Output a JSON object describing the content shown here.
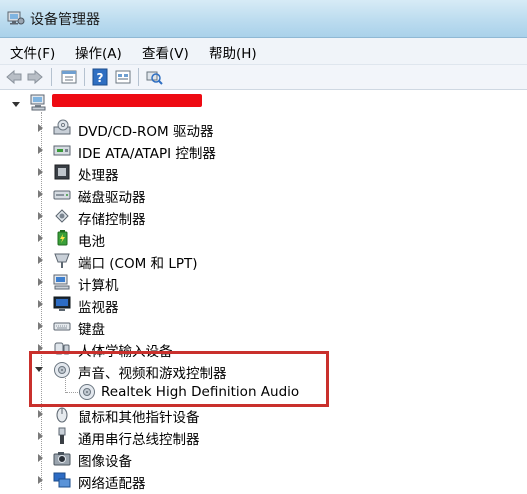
{
  "window": {
    "title": "设备管理器"
  },
  "menu": [
    "文件(F)",
    "操作(A)",
    "查看(V)",
    "帮助(H)"
  ],
  "toolbar": {
    "buttons": [
      "back-icon",
      "forward-icon",
      "properties-icon",
      "help-icon",
      "show-hidden-icon",
      "scan-hardware-icon"
    ]
  },
  "tree": {
    "root": {
      "label": "",
      "icon": "computer-icon"
    },
    "items": [
      {
        "label": "DVD/CD-ROM 驱动器",
        "icon": "dvd-drive-icon"
      },
      {
        "label": "IDE ATA/ATAPI 控制器",
        "icon": "ide-controller-icon"
      },
      {
        "label": "处理器",
        "icon": "processor-icon"
      },
      {
        "label": "磁盘驱动器",
        "icon": "disk-drive-icon"
      },
      {
        "label": "存储控制器",
        "icon": "storage-controller-icon"
      },
      {
        "label": "电池",
        "icon": "battery-icon"
      },
      {
        "label": "端口 (COM 和 LPT)",
        "icon": "port-icon"
      },
      {
        "label": "计算机",
        "icon": "computer-icon"
      },
      {
        "label": "监视器",
        "icon": "monitor-icon"
      },
      {
        "label": "键盘",
        "icon": "keyboard-icon"
      },
      {
        "label": "人体学输入设备",
        "icon": "hid-icon"
      },
      {
        "label": "声音、视频和游戏控制器",
        "icon": "speaker-icon",
        "expanded": true
      },
      {
        "label": "Realtek High Definition Audio",
        "icon": "audio-device-icon",
        "child": true
      },
      {
        "label": "鼠标和其他指针设备",
        "icon": "mouse-icon"
      },
      {
        "label": "通用串行总线控制器",
        "icon": "usb-icon"
      },
      {
        "label": "图像设备",
        "icon": "camera-icon"
      },
      {
        "label": "网络适配器",
        "icon": "network-icon"
      }
    ]
  },
  "colors": {
    "highlight": "#c9302c",
    "redaction": "#ee0a12"
  }
}
